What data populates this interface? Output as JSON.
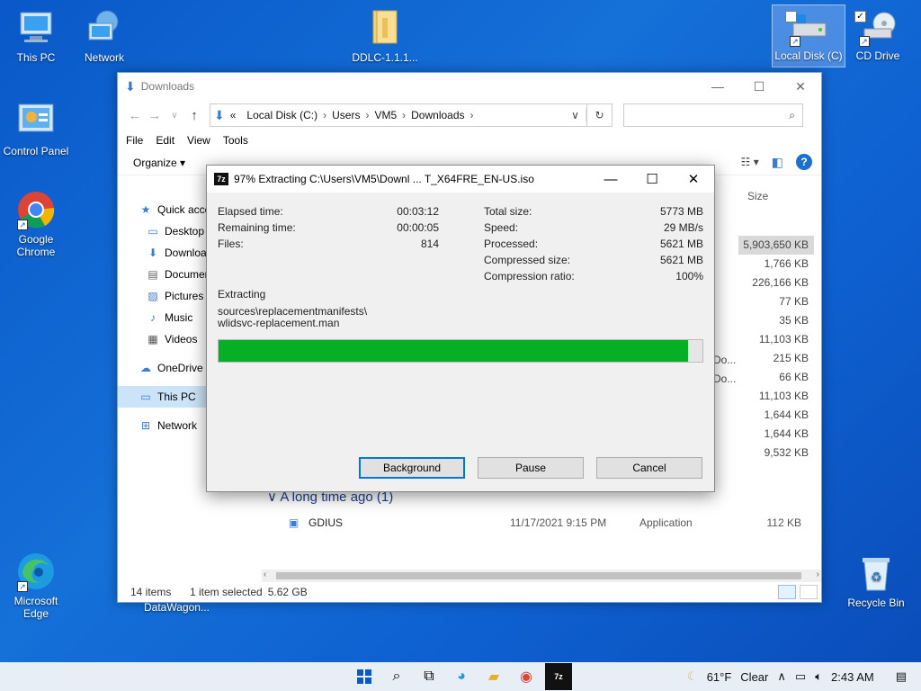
{
  "desktop": {
    "icons": [
      {
        "label": "This PC"
      },
      {
        "label": "Network"
      },
      {
        "label": "DDLC-1.1.1..."
      },
      {
        "label": "Local Disk (C)"
      },
      {
        "label": "CD Drive"
      },
      {
        "label": "Control Panel"
      },
      {
        "label": "Google Chrome"
      },
      {
        "label": "Microsoft Edge"
      },
      {
        "label": "Recycle Bin"
      }
    ],
    "partial_label": "DataWagon..."
  },
  "explorer": {
    "title": "Downloads",
    "breadcrumb": [
      "«",
      "Local Disk (C:)",
      "Users",
      "VM5",
      "Downloads"
    ],
    "menu": [
      "File",
      "Edit",
      "View",
      "Tools"
    ],
    "organize": "Organize ▾",
    "nav": [
      {
        "label": "Quick access",
        "icon": "star-icon"
      },
      {
        "label": "Desktop",
        "icon": "desktop-icon"
      },
      {
        "label": "Downloads",
        "icon": "download-icon"
      },
      {
        "label": "Documents",
        "icon": "document-icon"
      },
      {
        "label": "Pictures",
        "icon": "pictures-icon"
      },
      {
        "label": "Music",
        "icon": "music-icon"
      },
      {
        "label": "Videos",
        "icon": "videos-icon"
      },
      {
        "label": "OneDrive",
        "icon": "cloud-icon"
      },
      {
        "label": "This PC",
        "icon": "pc-icon"
      },
      {
        "label": "Network",
        "icon": "network-icon"
      }
    ],
    "size_header": "Size",
    "sizes": [
      "5,903,650 KB",
      "1,766 KB",
      "226,166 KB",
      "77 KB",
      "35 KB",
      "11,103 KB",
      "215 KB",
      "66 KB",
      "11,103 KB",
      "1,644 KB",
      "1,644 KB",
      "9,532 KB"
    ],
    "do_cells": [
      "Do...",
      "Do..."
    ],
    "group_header": "∨ A long time ago (1)",
    "file": {
      "name": "GDIUS",
      "date": "11/17/2021 9:15 PM",
      "type": "Application",
      "size": "112 KB"
    },
    "status": {
      "items": "14 items",
      "selected": "1 item selected",
      "selected_size": "5.62 GB"
    }
  },
  "dialog": {
    "title": "97% Extracting C:\\Users\\VM5\\Downl ... T_X64FRE_EN-US.iso",
    "left": [
      {
        "k": "Elapsed time:",
        "v": "00:03:12"
      },
      {
        "k": "Remaining time:",
        "v": "00:00:05"
      },
      {
        "k": "Files:",
        "v": "814"
      }
    ],
    "right": [
      {
        "k": "Total size:",
        "v": "5773 MB"
      },
      {
        "k": "Speed:",
        "v": "29 MB/s"
      },
      {
        "k": "Processed:",
        "v": "5621 MB"
      },
      {
        "k": "Compressed size:",
        "v": "5621 MB"
      },
      {
        "k": "Compression ratio:",
        "v": "100%"
      }
    ],
    "status_label": "Extracting",
    "path_line1": "sources\\replacementmanifests\\",
    "path_line2": "wlidsvc-replacement.man",
    "progress": 0.97,
    "buttons": {
      "background": "Background",
      "pause": "Pause",
      "cancel": "Cancel"
    }
  },
  "taskbar": {
    "weather_temp": "61°F",
    "weather_text": "Clear",
    "time": "2:43 AM"
  },
  "colors": {
    "progress": "#06b025",
    "accent": "#0078d7"
  }
}
